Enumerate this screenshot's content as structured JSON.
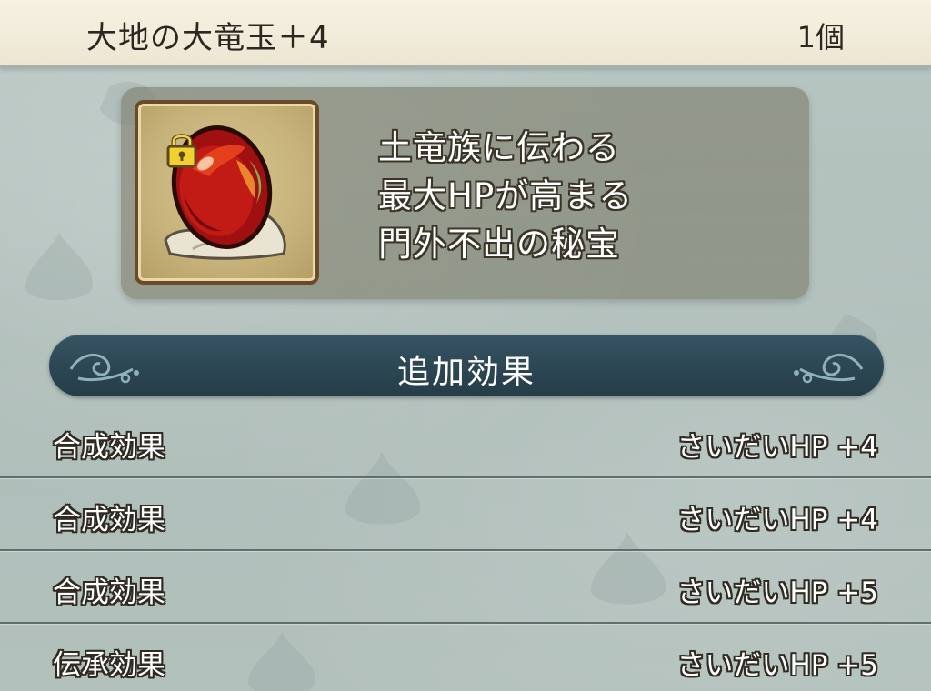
{
  "header": {
    "item_name": "大地の大竜玉＋4",
    "count": "1個"
  },
  "item": {
    "icon": "dragon-orb-icon",
    "locked": true,
    "lock_icon": "lock-icon",
    "description": [
      "土竜族に伝わる",
      "最大HPが高まる",
      "門外不出の秘宝"
    ]
  },
  "section": {
    "title": "追加効果"
  },
  "effects": [
    {
      "label": "合成効果",
      "value": "さいだいHP +4"
    },
    {
      "label": "合成効果",
      "value": "さいだいHP +4"
    },
    {
      "label": "合成効果",
      "value": "さいだいHP +5"
    },
    {
      "label": "伝承効果",
      "value": "さいだいHP +5"
    }
  ],
  "colors": {
    "header_bg": "#f0ebda",
    "section_bg": "#2c4653",
    "panel_bg": "#767460",
    "orb_red": "#b31616"
  }
}
